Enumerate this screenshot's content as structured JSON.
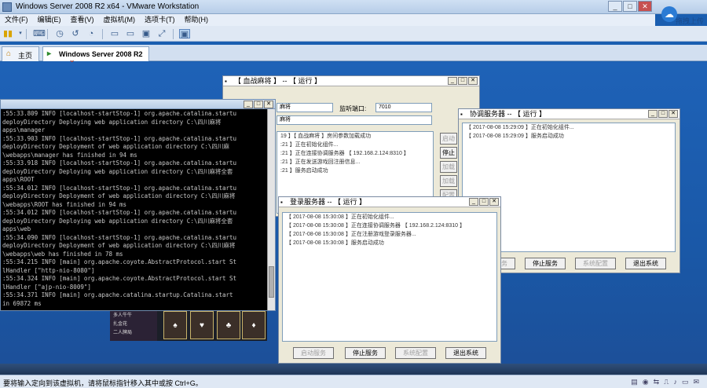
{
  "host": {
    "title": "Windows Server 2008 R2 x64 - VMware Workstation",
    "upload_label": "拖拽上传",
    "menu": [
      "文件(F)",
      "编辑(E)",
      "查看(V)",
      "虚拟机(M)",
      "选项卡(T)",
      "帮助(H)"
    ],
    "tabs": [
      {
        "label": "主页"
      },
      {
        "label": "Windows Server 2008 R2 ...",
        "close": "×"
      }
    ],
    "status_text": "要将输入定向到该虚拟机，请将鼠标指针移入其中或按 Ctrl+G。"
  },
  "console": {
    "lines": [
      ":55:33.809 INFO [localhost-startStop-1] org.apache.catalina.startu",
      "deployDirectory Deploying web application directory C:\\四川麻将",
      "apps\\manager",
      ":55:33.903 INFO [localhost-startStop-1] org.apache.catalina.startu",
      "deployDirectory Deployment of web application directory C:\\四川麻",
      "\\webapps\\manager has finished in 94 ms",
      ":55:33.918 INFO [localhost-startStop-1] org.apache.catalina.startu",
      "deployDirectory Deploying web application directory C:\\四川麻将全套",
      "apps\\ROOT",
      ":55:34.012 INFO [localhost-startStop-1] org.apache.catalina.startu",
      "deployDirectory Deployment of web application directory C:\\四川麻将",
      "\\webapps\\ROOT has finished in 94 ms",
      ":55:34.012 INFO [localhost-startStop-1] org.apache.catalina.startu",
      "deployDirectory Deploying web application directory C:\\四川麻将全套",
      "apps\\web",
      ":55:34.090 INFO [localhost-startStop-1] org.apache.catalina.startu",
      "deployDirectory Deployment of web application directory C:\\四川麻将",
      "\\webapps\\web has finished in 78 ms",
      ":55:34.215 INFO [main] org.apache.coyote.AbstractProtocol.start St",
      "lHandler [\"http-nio-8080\"]",
      ":55:34.324 INFO [main] org.apache.coyote.AbstractProtocol.start St",
      "lHandler [\"ajp-nio-8009\"]",
      ":55:34.371 INFO [main] org.apache.catalina.startup.Catalina.start",
      "in 69872 ms"
    ]
  },
  "xuezhan": {
    "title": "【 血战麻将 】 -- 【 运行 】",
    "name_value": "麻将",
    "port_label": "监听端口:",
    "port_value": "7010",
    "row2_value": "麻将",
    "logs": [
      "19 】【 血战麻将 】房间参数加载成功",
      ":21 】正在初始化组件...",
      ":21 】正在连接协调服务器 【 192.168.2.124:8310 】",
      ":21 】正在发送游戏回注册信息...",
      ":21 】服务启动成功"
    ],
    "side_buttons": [
      "启动",
      "停止",
      "加载",
      "加载",
      "配置"
    ]
  },
  "xietiao": {
    "title": "协调服务器 -- 【 运行 】",
    "logs": [
      "【 2017-08-08 15:29:09 】正在初始化组件...",
      "【 2017-08-08 15:29:09 】服务启动成功"
    ],
    "buttons": [
      "启动服务",
      "停止服务",
      "系统配置",
      "退出系统"
    ]
  },
  "denglu": {
    "title": "登录服务器 -- 【 运行 】",
    "logs": [
      "【 2017-08-08 15:30:08 】正在初始化组件...",
      "【 2017-08-08 15:30:08 】正在连接协调服务器 【 192.168.2.124:8310 】",
      "【 2017-08-08 15:30:08 】正在注册游戏登录服务器...",
      "【 2017-08-08 15:30:08 】服务启动成功"
    ],
    "buttons": [
      "启动服务",
      "停止服务",
      "系统配置",
      "退出系统"
    ]
  },
  "game": {
    "menu_items": [
      "多人牛牛",
      "扎金花",
      "二人牌局"
    ]
  }
}
